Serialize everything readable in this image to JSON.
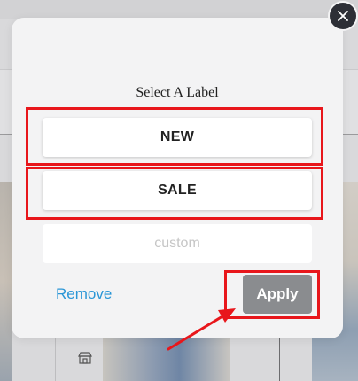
{
  "dialog": {
    "title": "Select A Label",
    "options": [
      {
        "label": "NEW"
      },
      {
        "label": "SALE"
      }
    ],
    "custom_input": {
      "placeholder": "custom",
      "value": ""
    },
    "remove_label": "Remove",
    "apply_label": "Apply"
  },
  "icons": {
    "close": "close-icon",
    "background_store": "store-icon"
  },
  "colors": {
    "highlight": "#e8161b",
    "remove_link": "#2a96d6",
    "apply_button": "#8a8c8f",
    "close_button": "#2d2f36"
  }
}
